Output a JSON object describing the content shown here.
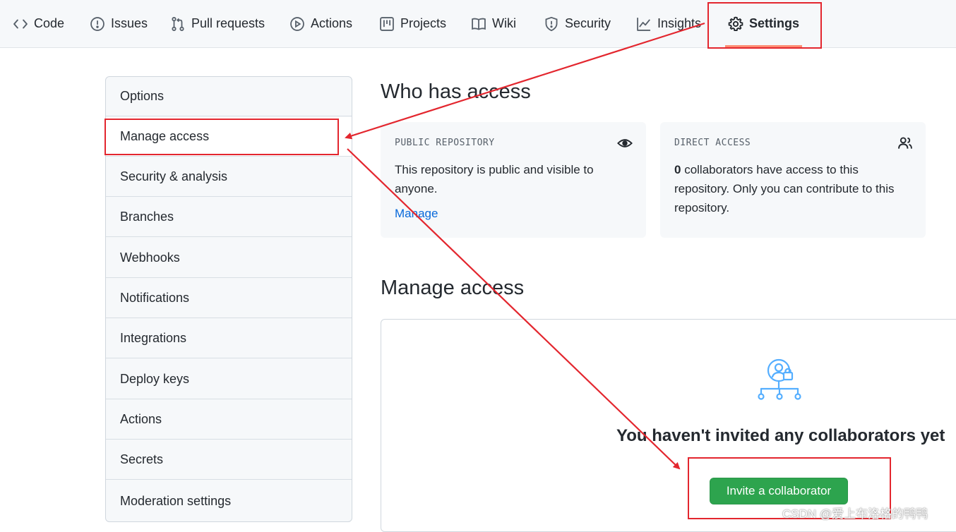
{
  "nav": {
    "tabs": [
      {
        "label": "Code",
        "icon": "code-icon"
      },
      {
        "label": "Issues",
        "icon": "issue-icon"
      },
      {
        "label": "Pull requests",
        "icon": "pull-request-icon"
      },
      {
        "label": "Actions",
        "icon": "play-icon"
      },
      {
        "label": "Projects",
        "icon": "project-icon"
      },
      {
        "label": "Wiki",
        "icon": "book-icon"
      },
      {
        "label": "Security",
        "icon": "shield-icon"
      },
      {
        "label": "Insights",
        "icon": "graph-icon"
      },
      {
        "label": "Settings",
        "icon": "gear-icon",
        "selected": true
      }
    ]
  },
  "sidebar": {
    "items": [
      {
        "label": "Options"
      },
      {
        "label": "Manage access",
        "active": true
      },
      {
        "label": "Security & analysis"
      },
      {
        "label": "Branches"
      },
      {
        "label": "Webhooks"
      },
      {
        "label": "Notifications"
      },
      {
        "label": "Integrations"
      },
      {
        "label": "Deploy keys"
      },
      {
        "label": "Actions"
      },
      {
        "label": "Secrets"
      },
      {
        "label": "Moderation settings"
      }
    ]
  },
  "who_has_access": {
    "title": "Who has access",
    "public": {
      "label": "PUBLIC REPOSITORY",
      "text_line1": "This repository is public and visible to",
      "text_line2": "anyone.",
      "link": "Manage",
      "icon": "eye-icon"
    },
    "direct": {
      "label": "DIRECT ACCESS",
      "count": "0",
      "text_line1": " collaborators have access to this",
      "text_line2": "repository. Only you can contribute to this",
      "text_line3": "repository.",
      "icon": "people-icon"
    }
  },
  "manage_access": {
    "title": "Manage access",
    "empty_title": "You haven't invited any collaborators yet",
    "invite_button": "Invite a collaborator",
    "illustration_icon": "person-lock-network-icon"
  },
  "watermark": "CSDN @爱上布洛格的鸭鸭",
  "colors": {
    "accent_green": "#2da44e",
    "link_blue": "#0969da",
    "annotation_red": "#e3262e",
    "illustration_blue": "#54aeff"
  }
}
